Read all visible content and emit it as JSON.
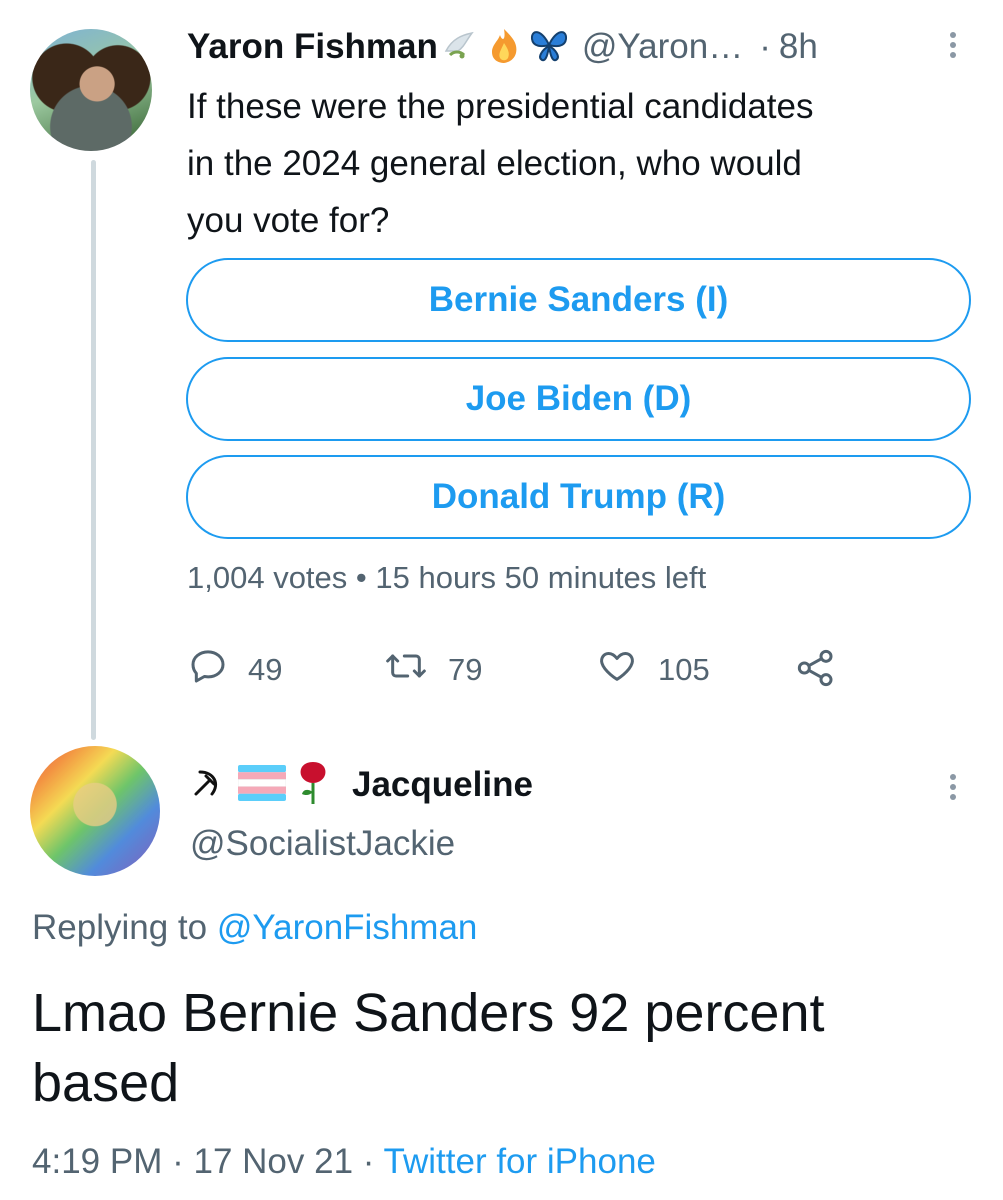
{
  "tweet": {
    "author_name": "Yaron Fishman",
    "author_handle": "@Yaron…",
    "separator": "·",
    "time_ago": "8h",
    "text_lines": [
      "If these were the presidential candidates",
      "in the 2024 general election, who would",
      "you vote for?"
    ],
    "poll": {
      "options": [
        "Bernie Sanders (I)",
        "Joe Biden (D)",
        "Donald Trump (R)"
      ],
      "votes": "1,004 votes",
      "dot": "•",
      "time_left": "15 hours 50 minutes left"
    },
    "actions": {
      "replies": "49",
      "retweets": "79",
      "likes": "105"
    }
  },
  "reply": {
    "author_name": "Jacqueline",
    "author_handle": "@SocialistJackie",
    "replying_prefix": "Replying to",
    "replying_to": "@YaronFishman",
    "text_lines": [
      "Lmao Bernie Sanders 92 percent",
      "based"
    ],
    "time": "4:19 PM",
    "date": "17 Nov 21",
    "sep": "·",
    "source": "Twitter for iPhone"
  },
  "colors": {
    "accent": "#1d9bf0",
    "text": "#0f1419",
    "muted": "#536471",
    "thread_line": "#cfd9de"
  },
  "icons": [
    "dove-emoji",
    "fire-emoji",
    "butterfly-emoji",
    "hammer-sickle-icon",
    "trans-flag-emoji",
    "rose-emoji",
    "more-icon",
    "reply-icon",
    "retweet-icon",
    "like-icon",
    "share-icon"
  ]
}
